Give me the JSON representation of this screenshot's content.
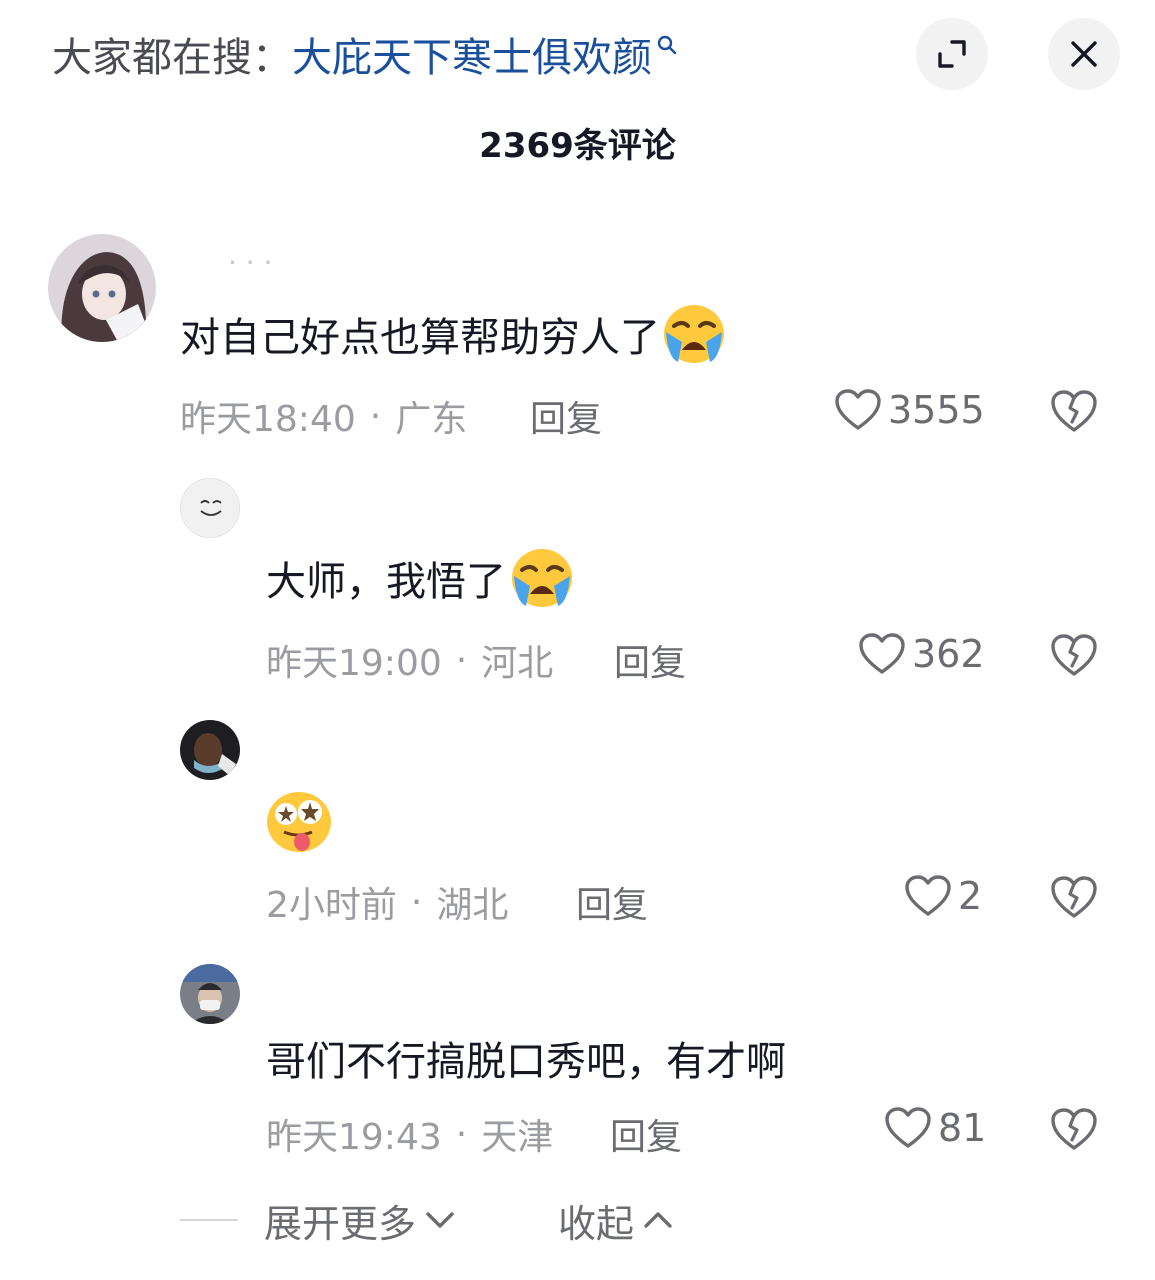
{
  "header": {
    "search_prefix": "大家都在搜：",
    "search_term": "大庇天下寒士俱欢颜",
    "comment_count_title": "2369条评论"
  },
  "comments": [
    {
      "username": "· · ·",
      "text": "对自己好点也算帮助穷人了",
      "emoji": "loudly-crying-face",
      "time": "昨天18:40",
      "location": "广东",
      "reply_label": "回复",
      "likes": "3555"
    },
    {
      "text": "大师，我悟了",
      "emoji": "loudly-crying-face",
      "time": "昨天19:00",
      "location": "河北",
      "reply_label": "回复",
      "likes": "362"
    },
    {
      "username": "",
      "text": "",
      "emoji": "dizzy-tongue-face",
      "time": "2小时前",
      "location": "湖北",
      "reply_label": "回复",
      "likes": "2"
    },
    {
      "text": "哥们不行搞脱口秀吧，有才啊",
      "time": "昨天19:43",
      "location": "天津",
      "reply_label": "回复",
      "likes": "81"
    }
  ],
  "footer": {
    "expand_more": "展开更多",
    "collapse": "收起"
  },
  "separator": "·",
  "colors": {
    "search_term": "#1a4f9c",
    "text": "#161823",
    "meta": "#9b9ca2",
    "button_bg": "#f2f2f3"
  }
}
